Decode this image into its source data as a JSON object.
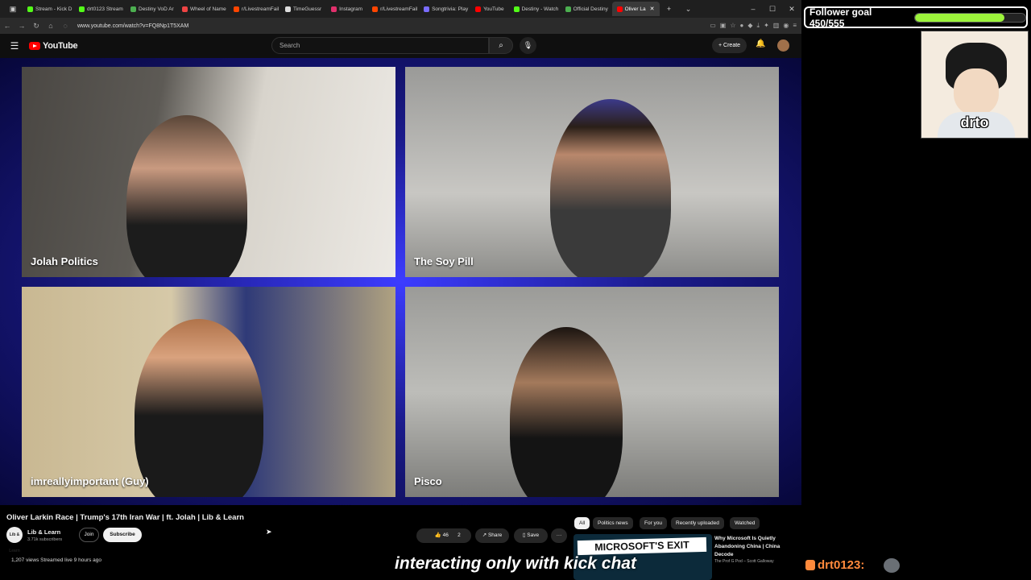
{
  "browser": {
    "tabs": [
      {
        "label": "Stream - Kick D",
        "color": "#53fc18",
        "active": false
      },
      {
        "label": "drt0123 Stream",
        "color": "#53fc18",
        "active": false
      },
      {
        "label": "Destiny VoD Ar",
        "color": "#4caf50",
        "active": false
      },
      {
        "label": "Wheel of Name",
        "color": "#e44",
        "active": false
      },
      {
        "label": "r/LivestreamFail",
        "color": "#ff4500",
        "active": false
      },
      {
        "label": "TimeGuessr",
        "color": "#ddd",
        "active": false
      },
      {
        "label": "Instagram",
        "color": "#e1306c",
        "active": false
      },
      {
        "label": "r/LivestreamFail",
        "color": "#ff4500",
        "active": false
      },
      {
        "label": "Songtrivia: Play",
        "color": "#7a6cff",
        "active": false
      },
      {
        "label": "YouTube",
        "color": "#f00",
        "active": false
      },
      {
        "label": "Destiny - Watch",
        "color": "#53fc18",
        "active": false
      },
      {
        "label": "Official Destiny",
        "color": "#4caf50",
        "active": false
      },
      {
        "label": "Oliver La",
        "color": "#f00",
        "active": true
      }
    ],
    "url": "www.youtube.com/watch?v=FQ8Np1T5XAM"
  },
  "youtube": {
    "logo_text": "YouTube",
    "search_placeholder": "Search",
    "create_label": "Create"
  },
  "video": {
    "participants": [
      {
        "name": "Jolah Politics"
      },
      {
        "name": "The Soy Pill"
      },
      {
        "name": "imreallyimportant (Guy)"
      },
      {
        "name": "Pisco"
      }
    ]
  },
  "details": {
    "title": "Oliver Larkin Race | Trump's 17th Iran War | ft. Jolah | Lib & Learn",
    "channel": "Lib & Learn",
    "channel_avatar_text": "Lib & Learn",
    "subscribers": "3.71k subscribers",
    "join_label": "Join",
    "subscribe_label": "Subscribe",
    "likes": "46",
    "comments": "2",
    "share_label": "Share",
    "save_label": "Save",
    "stats": "1,207 views  Streamed live 9 hours ago"
  },
  "recommendations": {
    "chips": [
      "All",
      "Politics news",
      "For you",
      "Recently uploaded",
      "Watched"
    ],
    "first": {
      "thumb_text": "MICROSOFT'S EXIT",
      "title": "Why Microsoft Is Quietly Abandoning China | China Decode",
      "meta": "The Prof G Pod – Scott Galloway"
    }
  },
  "overlay": {
    "goal_text": "Follower goal 450/555",
    "goal_fraction": 0.81,
    "cam_name": "drto",
    "caption": "interacting only with kick chat",
    "chat_user": "drt0123:"
  }
}
